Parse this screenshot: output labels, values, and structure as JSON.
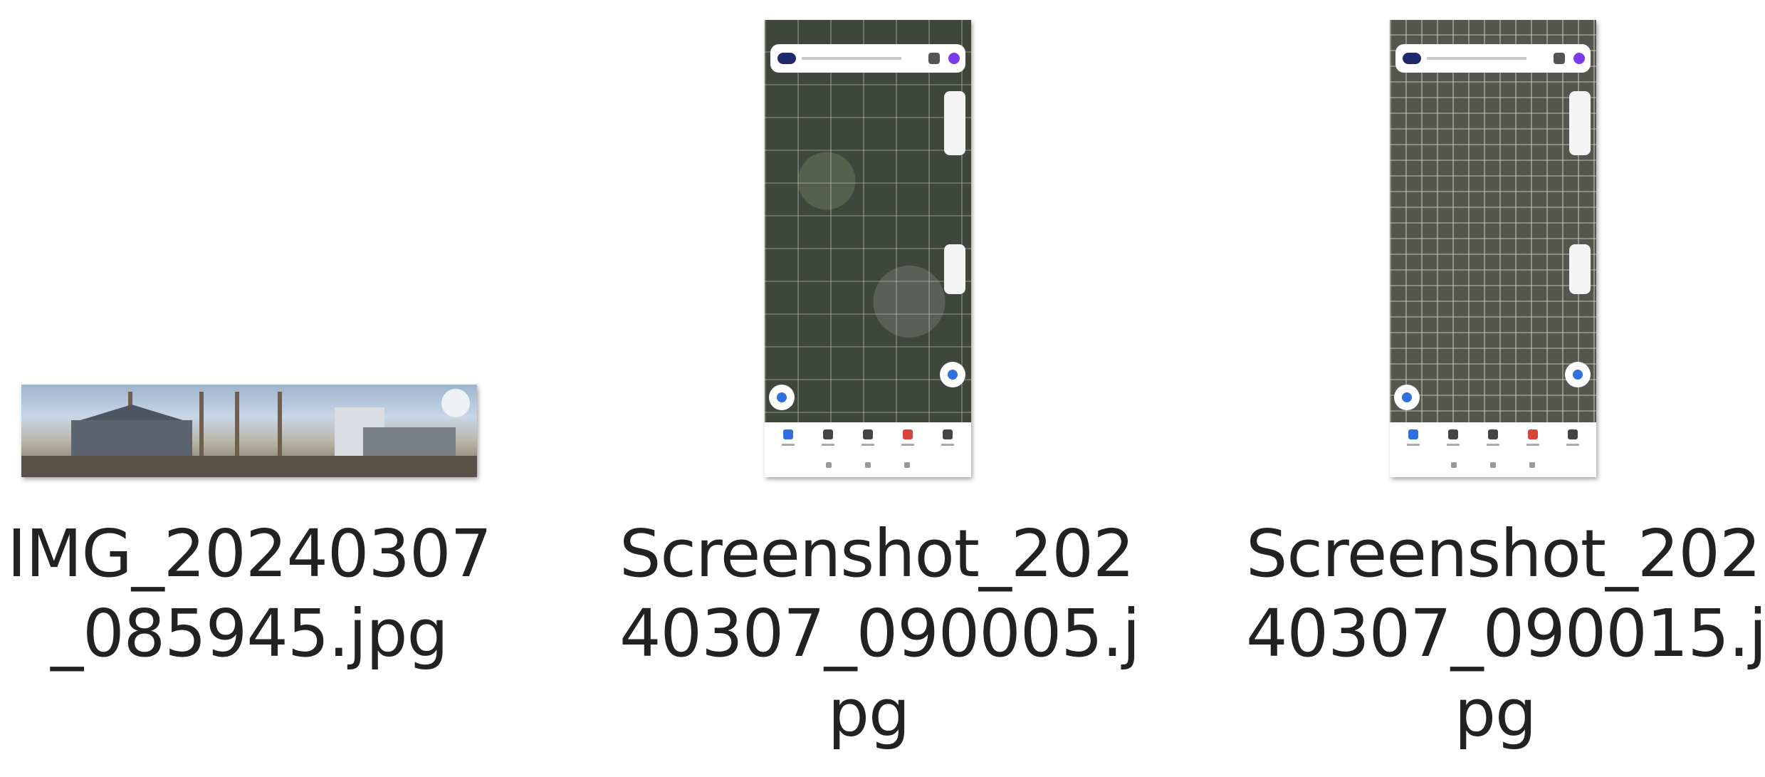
{
  "files": [
    {
      "name_lines": [
        "IMG_20240307",
        "_085945.jpg"
      ],
      "thumbnail_icon": "panorama-photo-thumbnail"
    },
    {
      "name_lines": [
        "Screenshot_202",
        "40307_090005.j",
        "pg"
      ],
      "thumbnail_icon": "map-screenshot-thumbnail"
    },
    {
      "name_lines": [
        "Screenshot_202",
        "40307_090015.j",
        "pg"
      ],
      "thumbnail_icon": "map-screenshot-thumbnail"
    }
  ],
  "colors": {
    "background": "#ffffff",
    "text": "#222222",
    "map_accent": "#2f6fe0"
  }
}
